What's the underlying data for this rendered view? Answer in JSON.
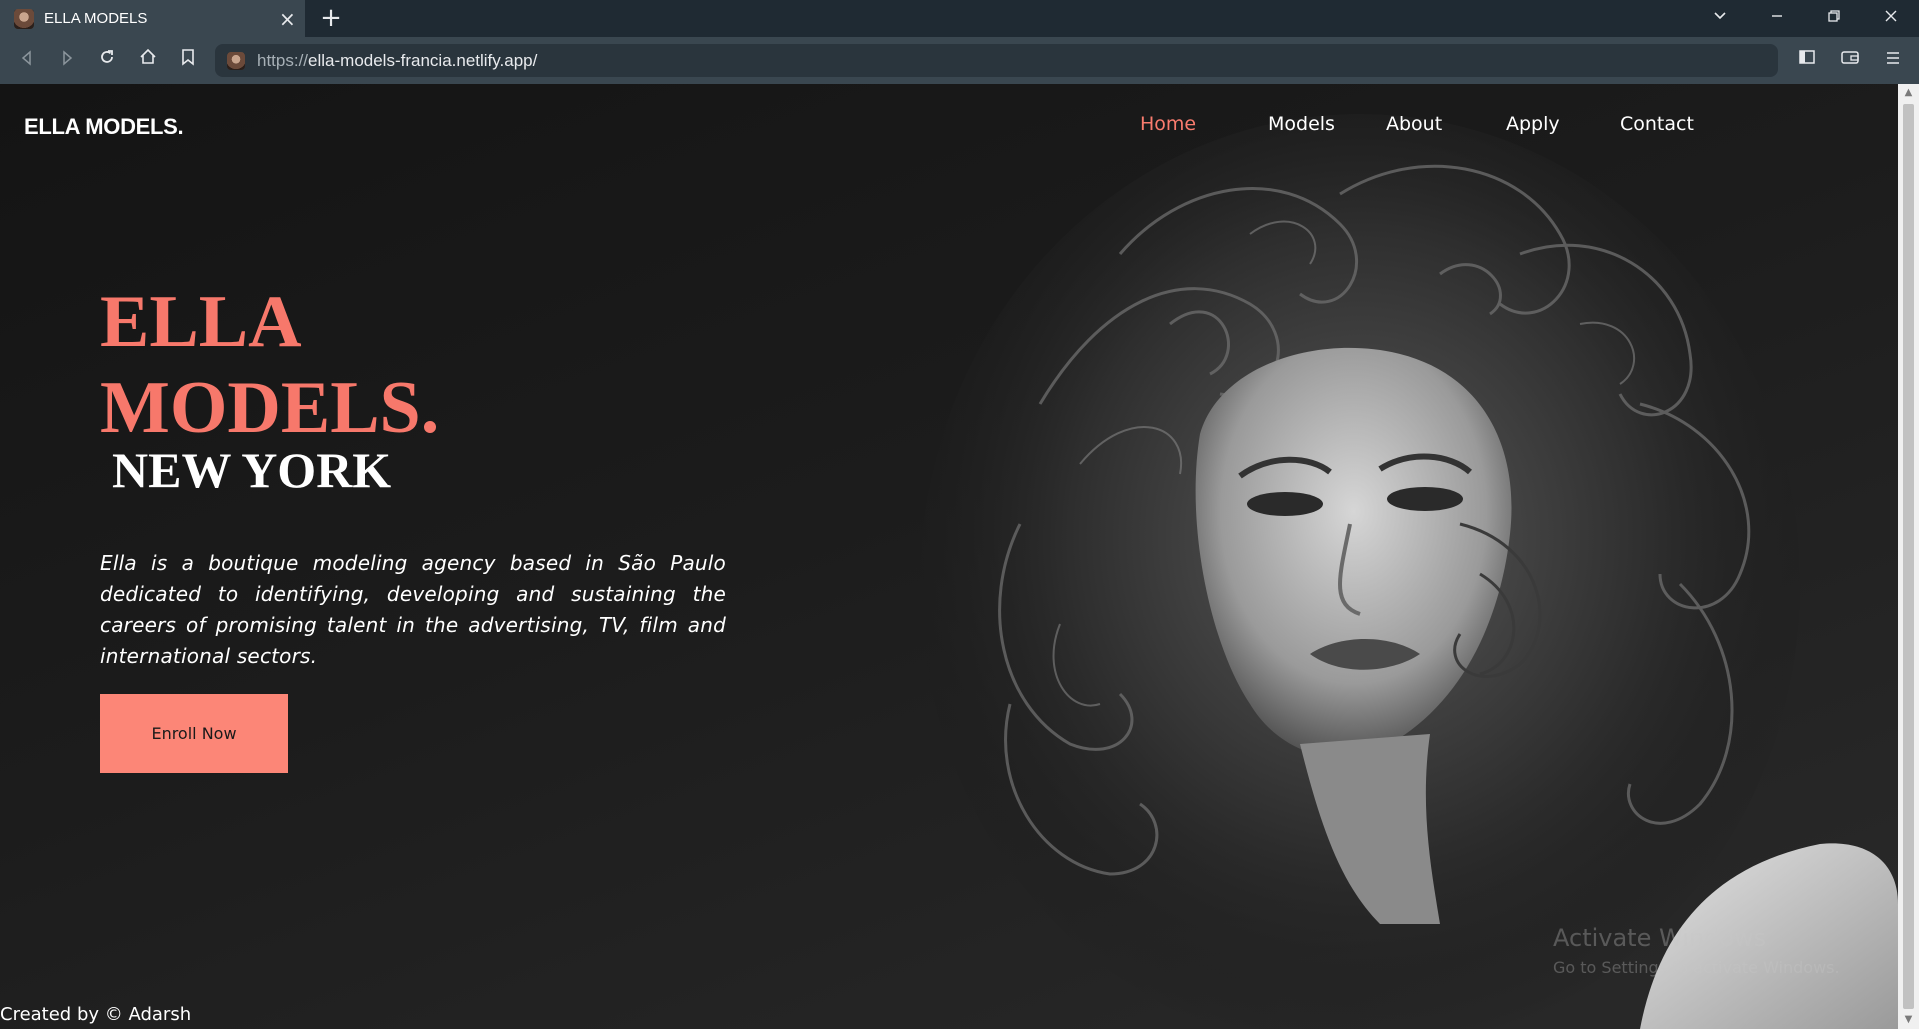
{
  "browser": {
    "tab_title": "ELLA MODELS",
    "url_scheme": "https://",
    "url_rest": "ella-models-francia.netlify.app/"
  },
  "site": {
    "brand": "ELLA MODELS.",
    "nav": [
      {
        "label": "Home",
        "active": true
      },
      {
        "label": "Models"
      },
      {
        "label": "About"
      },
      {
        "label": "Apply"
      },
      {
        "label": "Contact"
      }
    ],
    "hero": {
      "title_line1": "ELLA",
      "title_line2": "MODELS.",
      "city": "NEW YORK",
      "description": "Ella is a boutique modeling agency based in São Paulo dedicated to identifying, developing and sustaining the careers of promising talent in the advertising, TV, film and international sectors.",
      "cta": "Enroll Now"
    },
    "footer": "Created by © Adarsh"
  },
  "watermark": {
    "title": "Activate Windows",
    "subtitle": "Go to Settings to activate Windows."
  },
  "colors": {
    "accent": "#fa7c6e",
    "button": "#fc8677",
    "background": "#1b1b1b"
  }
}
